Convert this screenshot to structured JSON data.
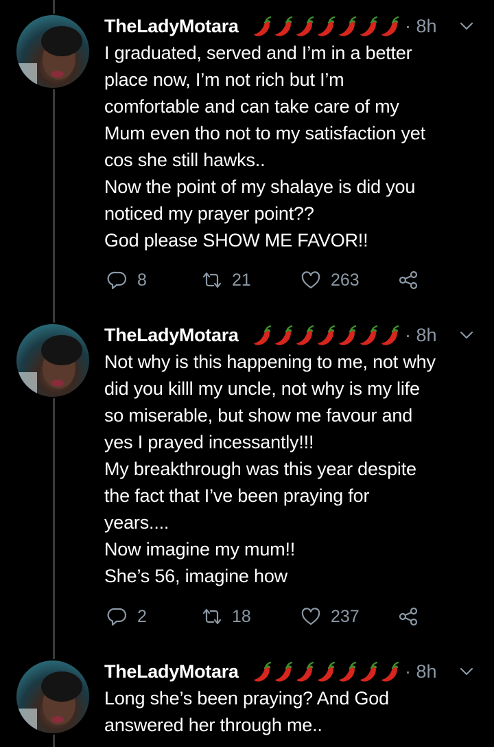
{
  "tweets": [
    {
      "name": "TheLadyMotara",
      "emoji": "chili-pepper",
      "emoji_count": 7,
      "dot": "·",
      "time": "8h",
      "text": "I graduated, served and I’m in a better\nplace now, I’m not rich but I’m\ncomfortable and can take care of my\nMum even tho not to my satisfaction yet\ncos she still hawks..\nNow the point of my shalaye is did you\nnoticed my prayer point??\nGod please SHOW ME FAVOR!!",
      "replies": "8",
      "retweets": "21",
      "likes": "263"
    },
    {
      "name": "TheLadyMotara",
      "emoji": "chili-pepper",
      "emoji_count": 7,
      "dot": "·",
      "time": "8h",
      "text": "Not why is this happening to me, not why\ndid you killl my uncle, not why is my life\nso miserable, but show me favour and\nyes I prayed incessantly!!!\nMy breakthrough was this year despite\nthe fact that I’ve been praying for\nyears....\nNow imagine my mum!!\nShe’s 56, imagine how",
      "replies": "2",
      "retweets": "18",
      "likes": "237"
    },
    {
      "name": "TheLadyMotara",
      "emoji": "chili-pepper",
      "emoji_count": 7,
      "dot": "·",
      "time": "8h",
      "text": "Long she’s been praying? And God\nanswered her through me.."
    }
  ],
  "colors": {
    "background": "#000000",
    "text": "#ffffff",
    "muted": "#8b98a5",
    "thread_line": "#3a3a3a",
    "chili": "#d7261e"
  },
  "icons": {
    "reply": "reply-icon",
    "retweet": "retweet-icon",
    "like": "heart-icon",
    "share": "share-icon",
    "menu": "chevron-down-icon"
  }
}
